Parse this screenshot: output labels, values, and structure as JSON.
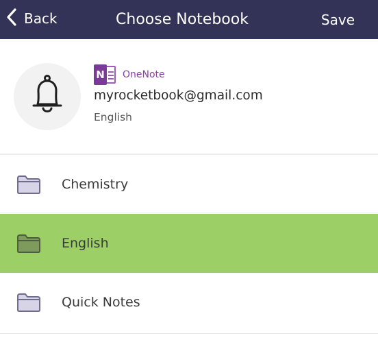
{
  "navbar": {
    "back_label": "Back",
    "title": "Choose Notebook",
    "save_label": "Save",
    "background": "#333358"
  },
  "account": {
    "avatar_icon": "bell-icon",
    "service_icon": "onenote-logo-icon",
    "service_icon_letter": "N",
    "service_name": "OneNote",
    "email": "myrocketbook@gmail.com",
    "current_notebook": "English"
  },
  "notebooks": [
    {
      "name": "Chemistry",
      "icon": "folder-icon",
      "selected": false
    },
    {
      "name": "English",
      "icon": "folder-icon",
      "selected": true
    },
    {
      "name": "Quick Notes",
      "icon": "folder-icon",
      "selected": false
    }
  ],
  "colors": {
    "selected_row": "#9ccf65",
    "onenote_purple": "#7b3a98"
  }
}
